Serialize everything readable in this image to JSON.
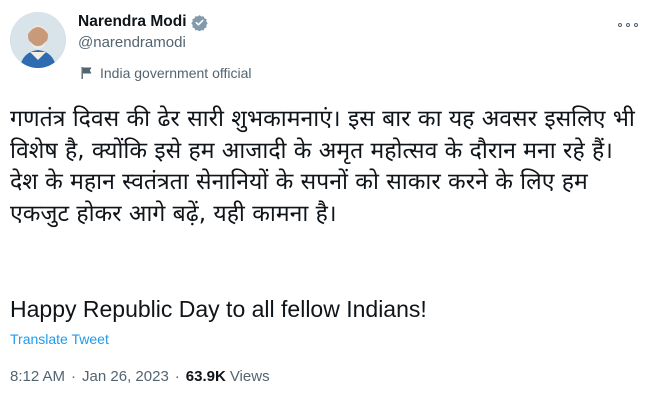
{
  "author": {
    "name": "Narendra Modi",
    "handle": "@narendramodi",
    "label": "India government official"
  },
  "tweet": {
    "text_hindi": "गणतंत्र दिवस की ढेर सारी शुभकामनाएं। इस बार का यह अवसर इसलिए भी विशेष है, क्योंकि इसे हम आजादी के अमृत महोत्सव के दौरान मना रहे हैं। देश के महान स्वतंत्रता सेनानियों के सपनों को साकार करने के लिए हम एकजुट होकर आगे बढ़ें, यही कामना है।",
    "text_english": "Happy Republic Day to all fellow Indians!",
    "translate_label": "Translate Tweet"
  },
  "meta": {
    "time": "8:12 AM",
    "separator": "·",
    "date": "Jan 26, 2023",
    "views_count": "63.9K",
    "views_label": "Views"
  },
  "colors": {
    "link": "#1d9bf0",
    "secondary_text": "#536471",
    "verified_badge": "#829aab"
  },
  "icons": {
    "verified": "verified-badge-icon",
    "label": "flag-icon",
    "more": "more-options-icon"
  }
}
